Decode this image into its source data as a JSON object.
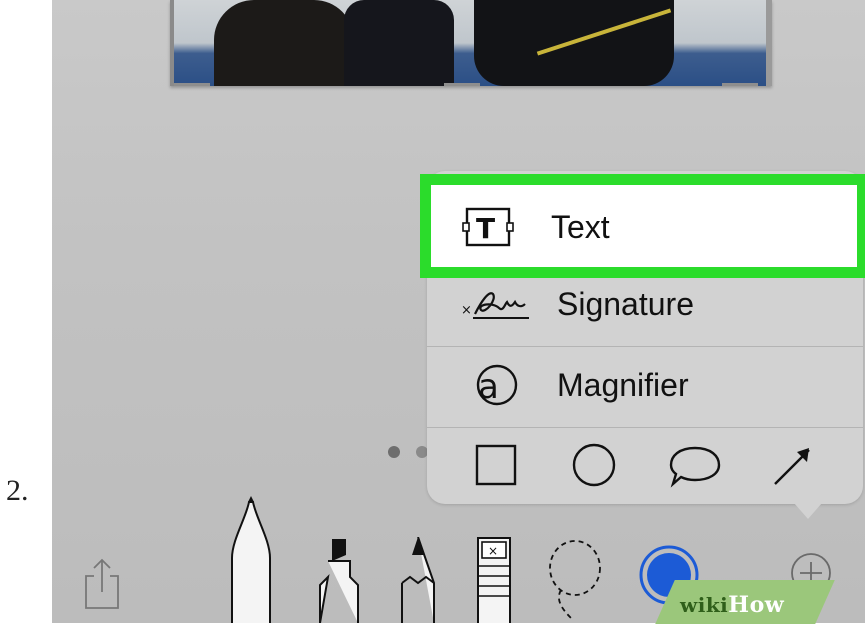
{
  "step": {
    "number": "2."
  },
  "photo": {
    "description_icon": "boxing-photo"
  },
  "menu": {
    "items": [
      {
        "label": "Text",
        "icon": "text-box-icon",
        "highlighted": true
      },
      {
        "label": "Signature",
        "icon": "signature-icon",
        "highlighted": false
      },
      {
        "label": "Magnifier",
        "icon": "magnifier-icon",
        "highlighted": false
      }
    ],
    "shapes": [
      "square-shape-icon",
      "circle-shape-icon",
      "speech-bubble-shape-icon",
      "arrow-shape-icon"
    ]
  },
  "toolbar": {
    "items": [
      "share-icon",
      "pen-tool-icon",
      "highlighter-tool-icon",
      "pencil-tool-icon",
      "eraser-tool-icon",
      "lasso-tool-icon",
      "color-picker-icon",
      "add-icon"
    ],
    "selected_color": "#1c5bd6"
  },
  "highlight_color": "#2bdc2b",
  "watermark": {
    "prefix": "wiki",
    "suffix": "How"
  }
}
